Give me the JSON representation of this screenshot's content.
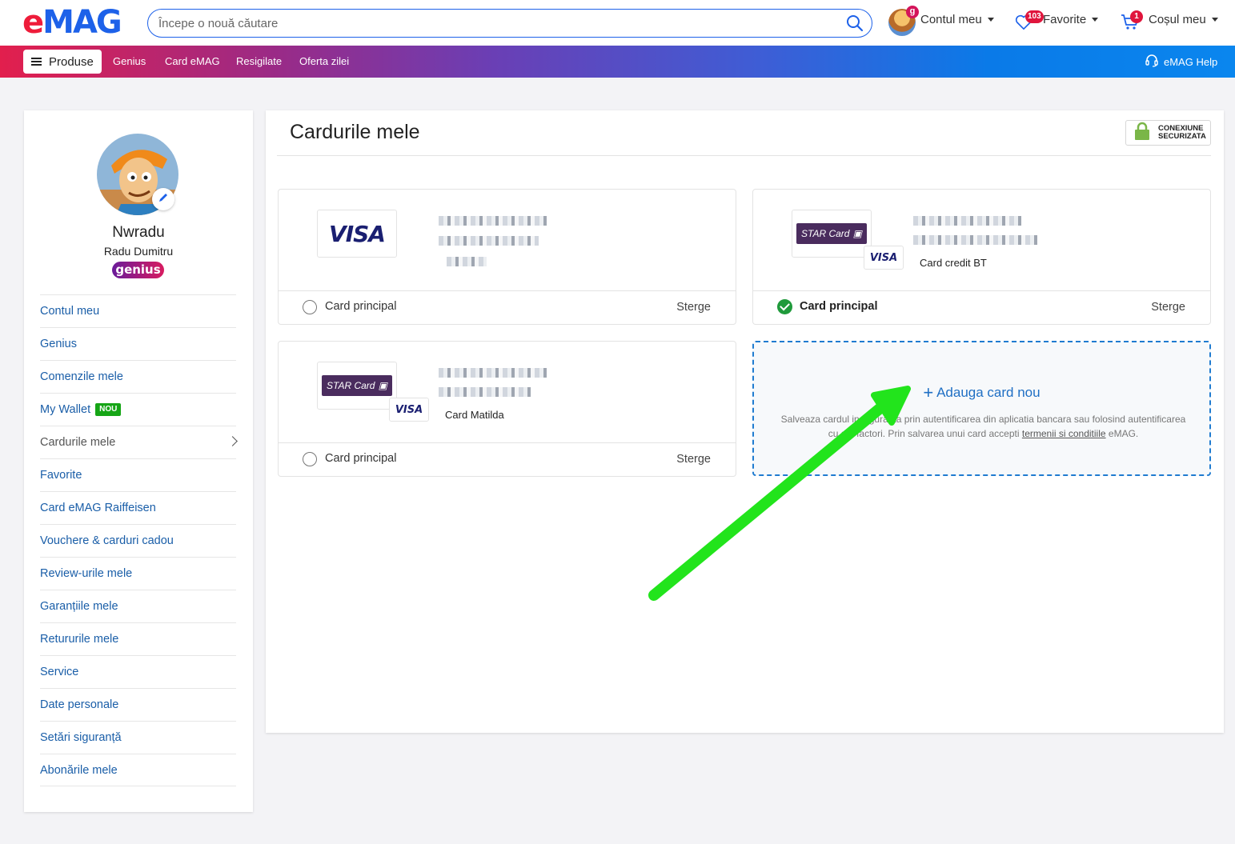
{
  "header": {
    "logo_e": "e",
    "logo_mag": "MAG",
    "search_placeholder": "Începe o nouă căutare",
    "account_label": "Contul meu",
    "account_badge": "g",
    "favorites_label": "Favorite",
    "favorites_badge": "103",
    "cart_label": "Coșul meu",
    "cart_badge": "1"
  },
  "nav": {
    "produse": "Produse",
    "links": [
      "Genius",
      "Card eMAG",
      "Resigilate",
      "Oferta zilei"
    ],
    "help": "eMAG Help"
  },
  "sidebar": {
    "username": "Nwradu",
    "fullname": "Radu Dumitru",
    "genius": "genius",
    "items": [
      {
        "label": "Contul meu"
      },
      {
        "label": "Genius"
      },
      {
        "label": "Comenzile mele"
      },
      {
        "label": "My Wallet",
        "badge": "NOU"
      },
      {
        "label": "Cardurile mele",
        "active": true
      },
      {
        "label": "Favorite"
      },
      {
        "label": "Card eMAG Raiffeisen"
      },
      {
        "label": "Vouchere & carduri cadou"
      },
      {
        "label": "Review-urile mele"
      },
      {
        "label": "Garanțiile mele"
      },
      {
        "label": "Retururile mele"
      },
      {
        "label": "Service"
      },
      {
        "label": "Date personale"
      },
      {
        "label": "Setări siguranță"
      },
      {
        "label": "Abonările mele"
      }
    ]
  },
  "main": {
    "title": "Cardurile mele",
    "secure_line1": "CONEXIUNE",
    "secure_line2": "SECURIZATA",
    "cards": [
      {
        "brand": "VISA",
        "name": "",
        "principal_label": "Card principal",
        "is_principal": false,
        "delete_label": "Sterge"
      },
      {
        "brand": "STAR Card",
        "mini_brand": "VISA",
        "name": "Card credit BT",
        "principal_label": "Card principal",
        "is_principal": true,
        "delete_label": "Sterge"
      },
      {
        "brand": "STAR Card",
        "mini_brand": "VISA",
        "name": "Card Matilda",
        "principal_label": "Card principal",
        "is_principal": false,
        "delete_label": "Sterge"
      }
    ],
    "add_card": {
      "title": "Adauga card nou",
      "desc_part1": "Salveaza cardul in siguranta prin autentificarea din aplicatia bancara sau folosind autentificarea cu doi factori. Prin salvarea unui card accepti ",
      "desc_link": "termenii si conditiile",
      "desc_part2": " eMAG."
    }
  },
  "colors": {
    "brand_red": "#ee1c3a",
    "brand_blue": "#1d61e9",
    "link_blue": "#1a5ea8",
    "success_green": "#1f9a3b",
    "annotation_arrow": "#22e41c"
  }
}
